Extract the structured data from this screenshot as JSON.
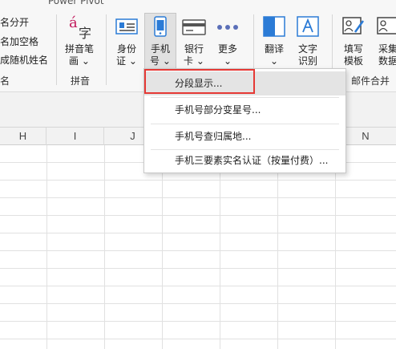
{
  "ribbon": {
    "top_partial": "Power Pivot",
    "name_tools": {
      "item1": "名分开",
      "item2": "名加空格",
      "item3": "成随机姓名",
      "group_label": "名"
    },
    "pinyin": {
      "label_line1": "拼音笔",
      "label_line2": "画",
      "group_label": "拼音",
      "icon_text_a": "á",
      "icon_text_zi": "字"
    },
    "id_card": {
      "label_line1": "身份",
      "label_line2": "证"
    },
    "phone": {
      "label_line1": "手机",
      "label_line2": "号"
    },
    "bank_card": {
      "label_line1": "银行",
      "label_line2": "卡"
    },
    "more": {
      "label": "更多"
    },
    "translate": {
      "label": "翻译"
    },
    "ocr": {
      "label_line1": "文字",
      "label_line2": "识别"
    },
    "fill_template": {
      "label_line1": "填写",
      "label_line2": "模板"
    },
    "collect_data": {
      "label_line1": "采集",
      "label_line2": "数据"
    },
    "mail_merge": {
      "group_label": "邮件合并"
    }
  },
  "grid": {
    "columns": [
      "H",
      "I",
      "J",
      "N"
    ]
  },
  "dropdown": {
    "items": [
      "分段显示...",
      "手机号部分变星号...",
      "手机号查归属地...",
      "手机三要素实名认证（按量付费）..."
    ]
  },
  "colors": {
    "highlight": "#e53935",
    "accent_blue": "#2b7bd6"
  }
}
